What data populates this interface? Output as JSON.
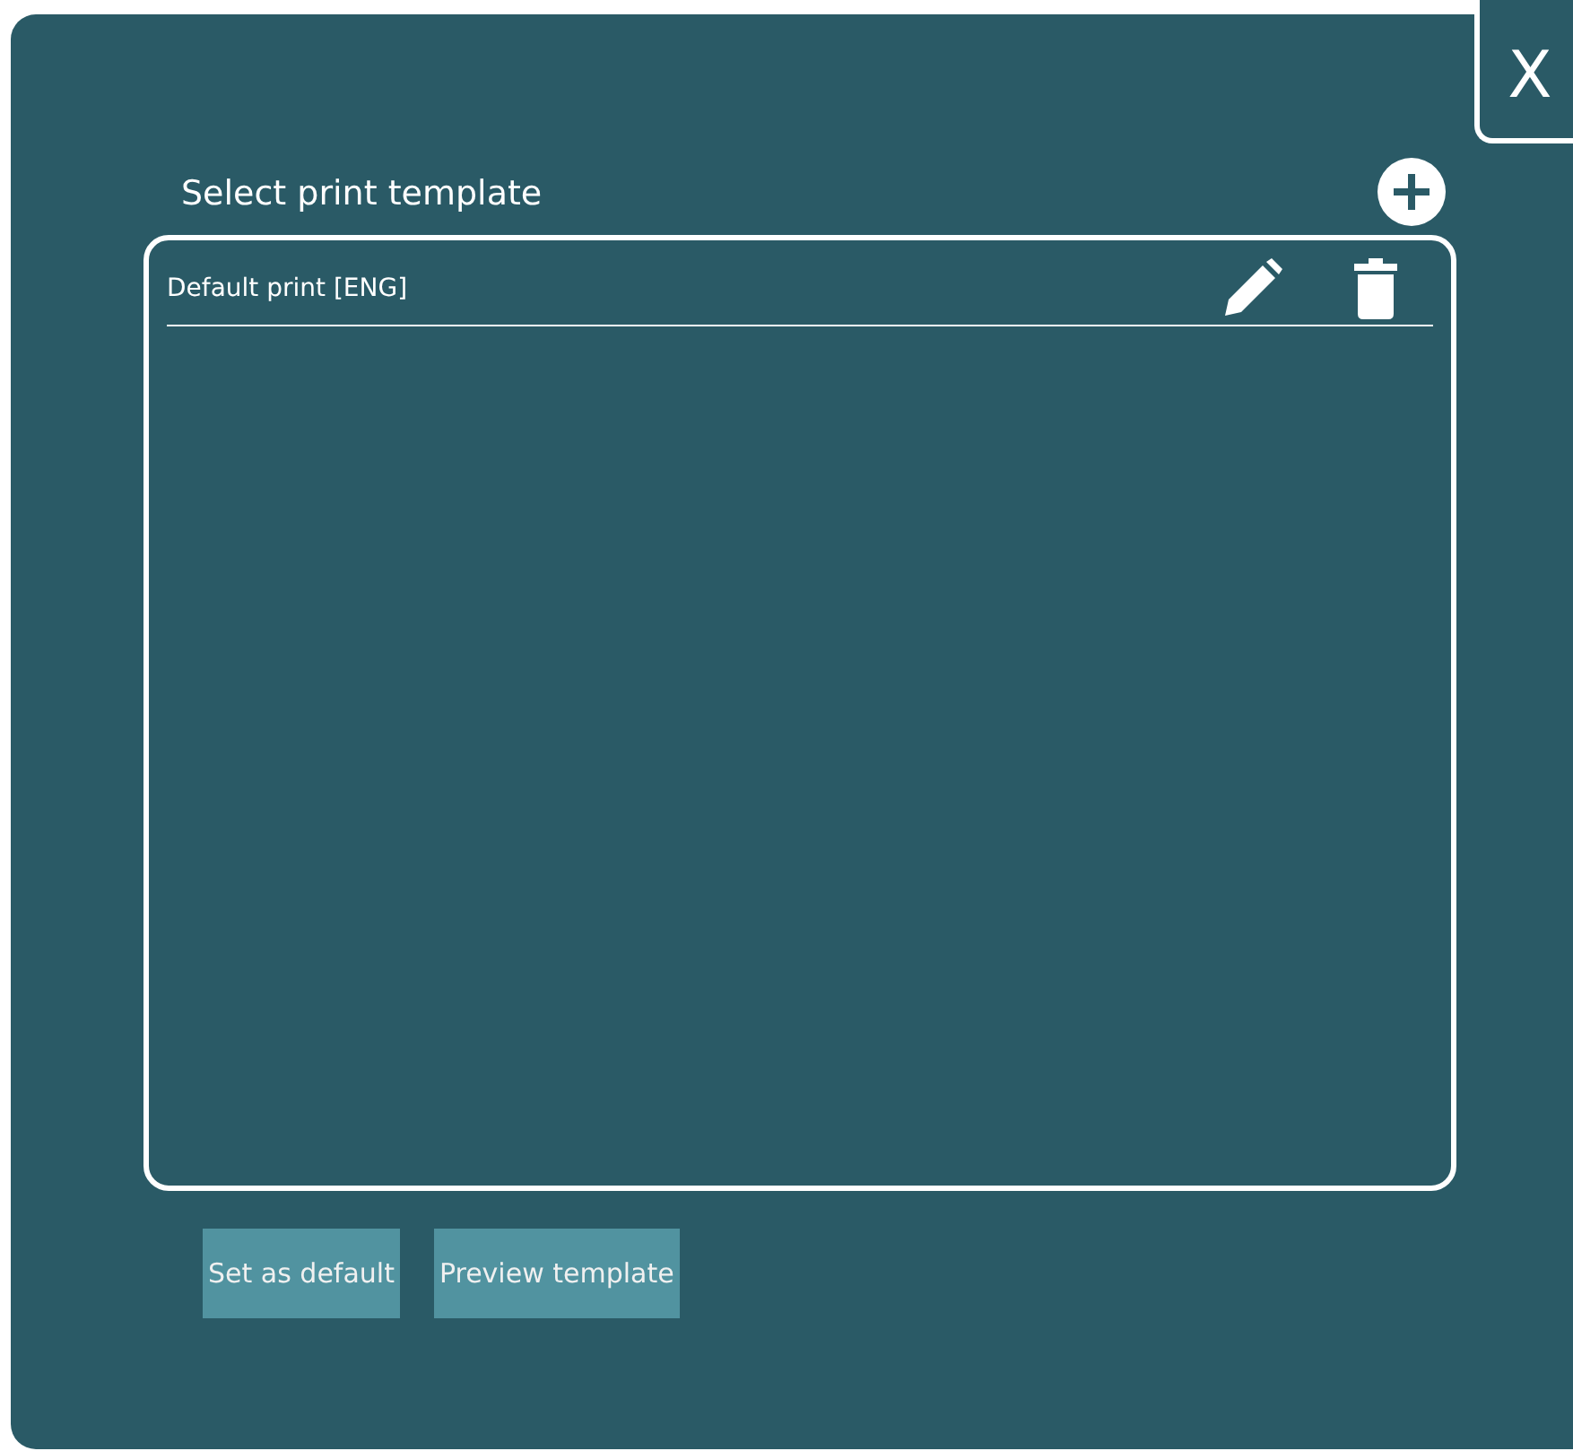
{
  "close_button": {
    "label": "X"
  },
  "title": "Select print template",
  "templates": [
    {
      "name": "Default print [ENG]"
    }
  ],
  "buttons": [
    {
      "label": "Set as default"
    },
    {
      "label": "Preview template"
    }
  ]
}
